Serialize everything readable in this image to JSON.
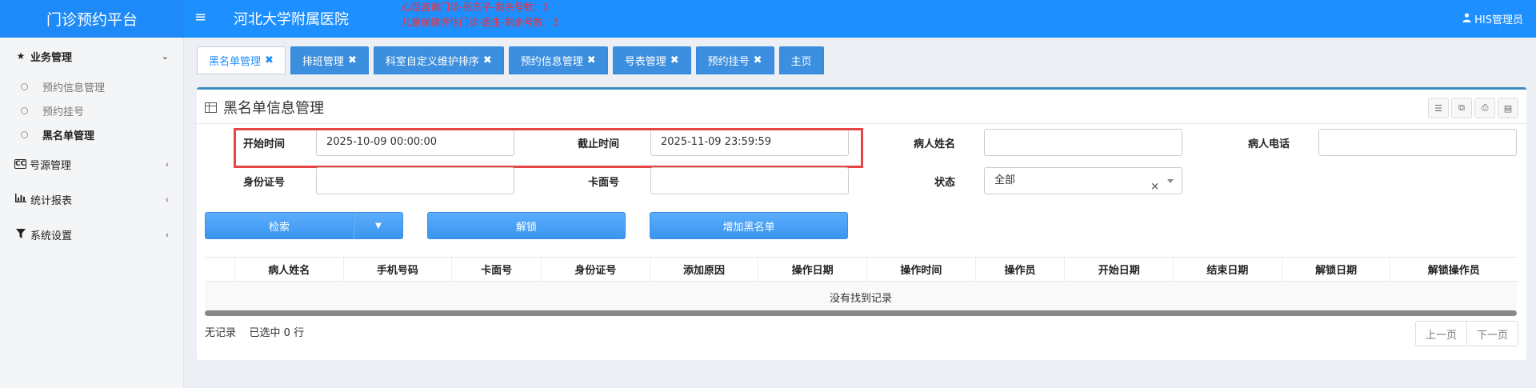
{
  "header": {
    "brand": "门诊预约平台",
    "hospital": "河北大学附属医院",
    "notices": [
      "心理咨询门诊-张东子-剩余号数：1",
      "儿童保健评估门诊-医生-剩余号数：3"
    ],
    "user": "HIS管理员"
  },
  "sidebar": {
    "groups": [
      {
        "label": "业务管理",
        "icon": "star-icon",
        "arrow": "⌄"
      },
      {
        "label": "号源管理",
        "icon": "cc-icon",
        "arrow": "‹"
      },
      {
        "label": "统计报表",
        "icon": "bar-chart-icon",
        "arrow": "‹"
      },
      {
        "label": "系统设置",
        "icon": "filter-icon",
        "arrow": "‹"
      }
    ],
    "sub_items": [
      "预约信息管理",
      "预约挂号",
      "黑名单管理"
    ]
  },
  "tabs": [
    {
      "label": "黑名单管理",
      "close": "✖"
    },
    {
      "label": "排班管理",
      "close": "✖"
    },
    {
      "label": "科室自定义维护排序",
      "close": "✖"
    },
    {
      "label": "预约信息管理",
      "close": "✖"
    },
    {
      "label": "号表管理",
      "close": "✖"
    },
    {
      "label": "预约挂号",
      "close": "✖"
    },
    {
      "label": "主页",
      "close": ""
    }
  ],
  "panel": {
    "title": "黑名单信息管理"
  },
  "form": {
    "start_label": "开始时间",
    "start_value": "2025-10-09 00:00:00",
    "end_label": "截止时间",
    "end_value": "2025-11-09 23:59:59",
    "name_label": "病人姓名",
    "name_value": "",
    "phone_label": "病人电话",
    "phone_value": "",
    "id_label": "身份证号",
    "id_value": "",
    "card_label": "卡面号",
    "card_value": "",
    "status_label": "状态",
    "status_value": "全部",
    "clear": "×"
  },
  "buttons": {
    "search": "检索",
    "unlock": "解锁",
    "add_blacklist": "增加黑名单"
  },
  "table": {
    "columns": [
      "",
      "病人姓名",
      "手机号码",
      "卡面号",
      "身份证号",
      "添加原因",
      "操作日期",
      "操作时间",
      "操作员",
      "开始日期",
      "结束日期",
      "解锁日期",
      "解锁操作员"
    ],
    "empty": "没有找到记录"
  },
  "footer": {
    "info": "无记录    已选中 0 行",
    "prev": "上一页",
    "next": "下一页"
  },
  "colors": {
    "primary": "#1e8fff",
    "highlight_box": "#e64545",
    "notice_text": "#ff2a2a"
  }
}
